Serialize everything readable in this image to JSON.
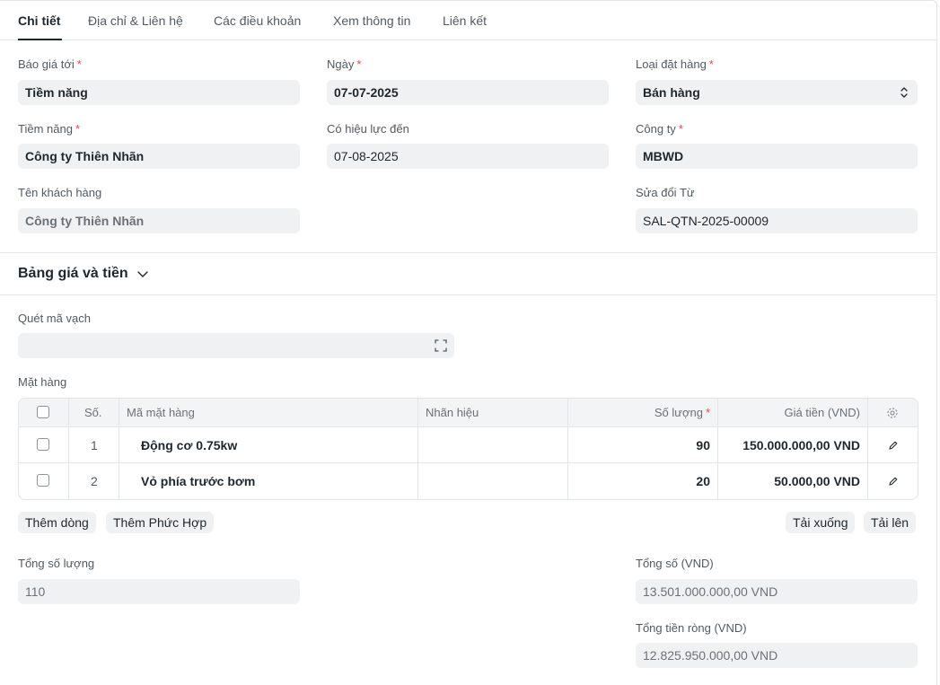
{
  "tabs": [
    {
      "label": "Chi tiết",
      "active": true
    },
    {
      "label": "Địa chỉ & Liên hệ"
    },
    {
      "label": "Các điều khoản"
    },
    {
      "label": "Xem thông tin"
    },
    {
      "label": "Liên kết"
    }
  ],
  "form": {
    "quotation_to": {
      "label": "Báo giá tới",
      "value": "Tiềm năng",
      "required": "*"
    },
    "date": {
      "label": "Ngày",
      "value": "07-07-2025",
      "required": "*"
    },
    "order_type": {
      "label": "Loại đặt hàng",
      "value": "Bán hàng",
      "required": "*"
    },
    "party": {
      "label": "Tiềm năng",
      "value": "Công ty Thiên Nhãn",
      "required": "*"
    },
    "valid_till": {
      "label": "Có hiệu lực đến",
      "value": "07-08-2025"
    },
    "company": {
      "label": "Công ty",
      "value": "MBWD",
      "required": "*"
    },
    "customer_name": {
      "label": "Tên khách hàng",
      "value": "Công ty Thiên Nhãn"
    },
    "amended_from": {
      "label": "Sửa đổi Từ",
      "value": "SAL-QTN-2025-00009"
    }
  },
  "section": {
    "title": "Bảng giá và tiền"
  },
  "barcode": {
    "label": "Quét mã vạch",
    "value": ""
  },
  "items": {
    "label": "Mặt hàng",
    "columns": {
      "no": "Số.",
      "item_code": "Mã mặt hàng",
      "brand": "Nhãn hiệu",
      "qty": "Số lượng",
      "qty_required": "*",
      "rate": "Giá tiền (VND)"
    },
    "rows": [
      {
        "no": "1",
        "item_code": "Động cơ 0.75kw",
        "brand": "",
        "qty": "90",
        "rate": "150.000.000,00 VND"
      },
      {
        "no": "2",
        "item_code": "Vỏ phía trước bơm",
        "brand": "",
        "qty": "20",
        "rate": "50.000,00 VND"
      }
    ]
  },
  "buttons": {
    "add_row": "Thêm dòng",
    "add_multiple": "Thêm Phức Hợp",
    "download": "Tải xuống",
    "upload": "Tải lên"
  },
  "totals": {
    "total_qty": {
      "label": "Tổng số lượng",
      "value": "110"
    },
    "total": {
      "label": "Tổng số (VND)",
      "value": "13.501.000.000,00 VND"
    },
    "net_total": {
      "label": "Tổng tiền ròng (VND)",
      "value": "12.825.950.000,00 VND"
    }
  },
  "colors": {
    "required": "#e24c4c",
    "field_bg": "#f0f1f2",
    "border": "#e2e6e9"
  },
  "icons": [
    "select-arrows-icon",
    "chevron-down-icon",
    "scan-icon",
    "settings-gear-icon",
    "edit-pencil-icon"
  ]
}
